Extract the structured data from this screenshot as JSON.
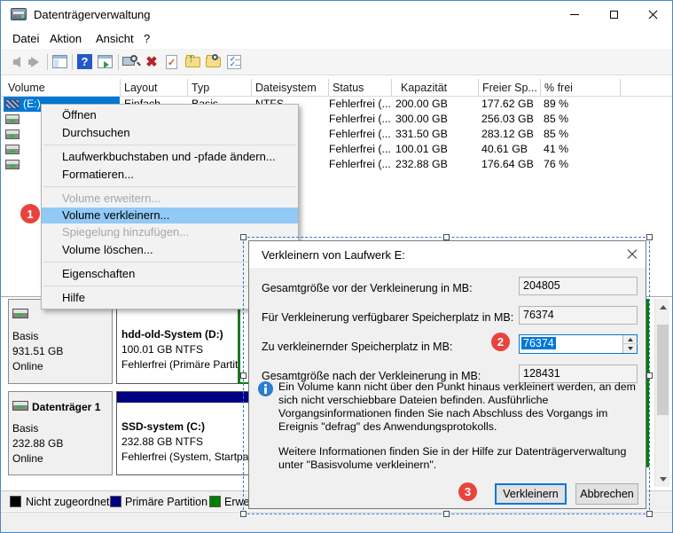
{
  "window": {
    "title": "Datenträgerverwaltung"
  },
  "menubar": {
    "items": [
      "Datei",
      "Aktion",
      "Ansicht",
      "?"
    ]
  },
  "toolbar": {
    "icons": [
      "back-arrow",
      "forward-arrow",
      "volume-list-view",
      "help",
      "graphical-view",
      "computer-search",
      "delete-x",
      "task-check",
      "folder-up",
      "folder-search",
      "checklist"
    ]
  },
  "volume_table": {
    "columns": [
      "Volume",
      "Layout",
      "Typ",
      "Dateisystem",
      "Status",
      "Kapazität",
      "Freier Sp...",
      "% frei"
    ],
    "rows": [
      {
        "volume": "(E:)",
        "layout": "Einfach",
        "typ": "Basis",
        "dateisystem": "NTFS",
        "status": "Fehlerfrei (...",
        "kapazitaet": "200.00 GB",
        "freier": "177.62 GB",
        "frei_prozent": "89 %"
      },
      {
        "volume": "",
        "layout": "",
        "typ": "",
        "dateisystem": "",
        "status": "Fehlerfrei (...",
        "kapazitaet": "300.00 GB",
        "freier": "256.03 GB",
        "frei_prozent": "85 %"
      },
      {
        "volume": "",
        "layout": "",
        "typ": "",
        "dateisystem": "",
        "status": "Fehlerfrei (...",
        "kapazitaet": "331.50 GB",
        "freier": "283.12 GB",
        "frei_prozent": "85 %"
      },
      {
        "volume": "",
        "layout": "",
        "typ": "",
        "dateisystem": "",
        "status": "Fehlerfrei (...",
        "kapazitaet": "100.01 GB",
        "freier": "40.61 GB",
        "frei_prozent": "41 %"
      },
      {
        "volume": "",
        "layout": "",
        "typ": "",
        "dateisystem": "",
        "status": "Fehlerfrei (...",
        "kapazitaet": "232.88 GB",
        "freier": "176.64 GB",
        "frei_prozent": "76 %"
      }
    ]
  },
  "context_menu": {
    "items": [
      {
        "label": "Öffnen"
      },
      {
        "label": "Durchsuchen"
      },
      {
        "label": "Laufwerkbuchstaben und -pfade ändern..."
      },
      {
        "label": "Formatieren..."
      },
      {
        "label": "Volume erweitern..."
      },
      {
        "label": "Volume verkleinern..."
      },
      {
        "label": "Spiegelung hinzufügen..."
      },
      {
        "label": "Volume löschen..."
      },
      {
        "label": "Eigenschaften"
      },
      {
        "label": "Hilfe"
      }
    ]
  },
  "badges": {
    "step1": "1",
    "step2": "2",
    "step3": "3"
  },
  "dialog": {
    "title": "Verkleinern von Laufwerk E:",
    "fields": [
      {
        "label": "Gesamtgröße vor der Verkleinerung in MB:",
        "value": "204805"
      },
      {
        "label": "Für Verkleinerung verfügbarer Speicherplatz in MB:",
        "value": "76374"
      },
      {
        "label": "Zu verkleinernder Speicherplatz in MB:",
        "value": "76374"
      },
      {
        "label": "Gesamtgröße nach der Verkleinerung in MB:",
        "value": "128431"
      }
    ],
    "info_text": "Ein Volume kann nicht über den Punkt hinaus verkleinert werden, an dem sich nicht verschiebbare Dateien befinden. Ausführliche Vorgangsinformationen finden Sie nach Abschluss des Vorgangs im Ereignis \"defrag\" des Anwendungsprotokolls.",
    "help_text": "Weitere Informationen finden Sie in der Hilfe zur Datenträgerverwaltung unter \"Basisvolume verkleinern\".",
    "buttons": {
      "shrink": "Verkleinern",
      "cancel": "Abbrechen"
    }
  },
  "disks": [
    {
      "name": "",
      "type": "Basis",
      "size": "931.51 GB",
      "status": "Online",
      "partition": {
        "title": "hdd-old-System  (D:)",
        "size": "100.01 GB NTFS",
        "status": "Fehlerfrei (Primäre Partit"
      }
    },
    {
      "name": "Datenträger 1",
      "type": "Basis",
      "size": "232.88 GB",
      "status": "Online",
      "partition": {
        "title": "SSD-system  (C:)",
        "size": "232.88 GB NTFS",
        "status": "Fehlerfrei (System, Startpa"
      }
    }
  ],
  "legend": [
    {
      "label": "Nicht zugeordnet",
      "color": "#000000"
    },
    {
      "label": "Primäre Partition",
      "color": "#000080"
    },
    {
      "label": "Erweiterte Partition",
      "color": "#008000"
    }
  ],
  "colors": {
    "accent": "#0078d7",
    "badge_red": "#e8443d",
    "menu_highlight": "#91c9f7",
    "primary_partition": "#000080",
    "extended_partition": "#008000",
    "unallocated": "#000000"
  }
}
